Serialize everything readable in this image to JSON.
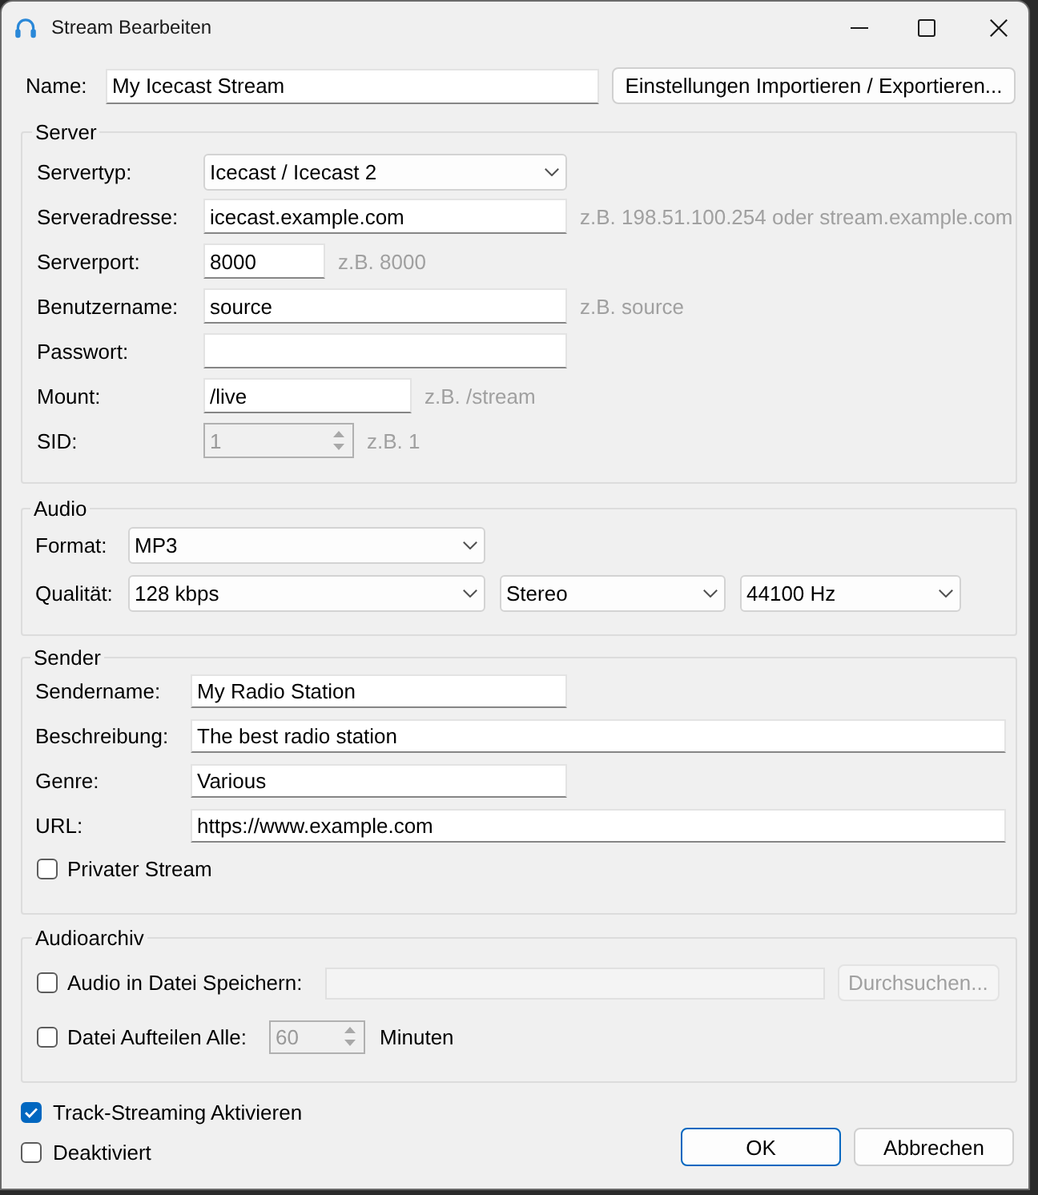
{
  "window": {
    "title": "Stream Bearbeiten"
  },
  "name": {
    "label": "Name:",
    "value": "My Icecast Stream"
  },
  "import_export_button": {
    "label": "Einstellungen Importieren / Exportieren..."
  },
  "server": {
    "title": "Server",
    "fields": [
      {
        "kind": "select",
        "label": "Servertyp:",
        "value": "Icecast / Icecast 2",
        "disabled": false
      },
      {
        "kind": "text",
        "label": "Serveradresse:",
        "value": "icecast.example.com",
        "hint": "z.B. 198.51.100.254 oder stream.example.com",
        "disabled": false
      },
      {
        "kind": "text",
        "label": "Serverport:",
        "value": "8000",
        "hint": "z.B. 8000",
        "disabled": false
      },
      {
        "kind": "text",
        "label": "Benutzername:",
        "value": "source",
        "hint": "z.B. source",
        "disabled": false
      },
      {
        "kind": "text",
        "label": "Passwort:",
        "disabled": false
      },
      {
        "kind": "text",
        "label": "Mount:",
        "value": "/live",
        "hint": "z.B. /stream",
        "disabled": false
      },
      {
        "kind": "spin",
        "label": "SID:",
        "value": "1",
        "hint": "z.B. 1",
        "disabled": true
      }
    ]
  },
  "audio": {
    "title": "Audio",
    "format": {
      "label": "Format:",
      "value": "MP3"
    },
    "quality": {
      "label": "Qualität:",
      "selects": [
        "128 kbps",
        "Stereo",
        "44100 Hz"
      ]
    }
  },
  "sender": {
    "title": "Sender",
    "fields": [
      {
        "label": "Sendername:",
        "value": "My Radio Station"
      },
      {
        "label": "Beschreibung:",
        "value": "The best radio station"
      },
      {
        "label": "Genre:",
        "value": "Various"
      },
      {
        "label": "URL:",
        "value": "https://www.example.com"
      }
    ],
    "private": {
      "label": "Privater Stream",
      "checked": false
    }
  },
  "archive": {
    "title": "Audioarchiv",
    "save": {
      "label": "Audio in Datei Speichern:",
      "checked": false,
      "path_field": {
        "disabled": true
      },
      "browse_button": {
        "label": "Durchsuchen...",
        "disabled": true
      }
    },
    "split": {
      "label": "Datei Aufteilen Alle:",
      "checked": false,
      "value": "60",
      "disabled": true,
      "unit": "Minuten"
    }
  },
  "options": [
    {
      "label": "Track-Streaming Aktivieren",
      "checked": true
    },
    {
      "label": "Deaktiviert",
      "checked": false
    }
  ],
  "buttons": [
    {
      "label": "OK",
      "default": true
    },
    {
      "label": "Abbrechen",
      "default": false
    }
  ]
}
